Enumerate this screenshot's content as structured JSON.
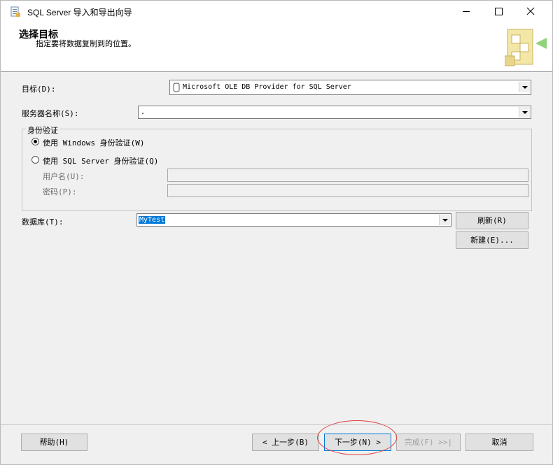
{
  "window": {
    "title": "SQL Server 导入和导出向导",
    "icons": [
      "app-icon",
      "minimize-icon",
      "maximize-icon",
      "close-icon"
    ]
  },
  "header": {
    "title": "选择目标",
    "subtitle": "指定要将数据复制到的位置。"
  },
  "destination": {
    "label": "目标(D):",
    "value": "Microsoft OLE DB Provider for SQL Server"
  },
  "server": {
    "label": "服务器名称(S):",
    "value": "."
  },
  "auth": {
    "group_label": "身份验证",
    "windows_label": "使用 Windows 身份验证(W)",
    "windows_selected": true,
    "sql_label": "使用 SQL Server 身份验证(Q)",
    "username_label": "用户名(U):",
    "password_label": "密码(P):"
  },
  "database": {
    "label": "数据库(T):",
    "value": "MyTest",
    "refresh_label": "刷新(R)",
    "new_label": "新建(E)..."
  },
  "footer": {
    "help_label": "帮助(H)",
    "back_label": "< 上一步(B)",
    "next_label": "下一步(N) >",
    "finish_label": "完成(F) >>|",
    "cancel_label": "取消"
  },
  "colors": {
    "highlight": "#0078d7",
    "annotation": "#e04040"
  }
}
